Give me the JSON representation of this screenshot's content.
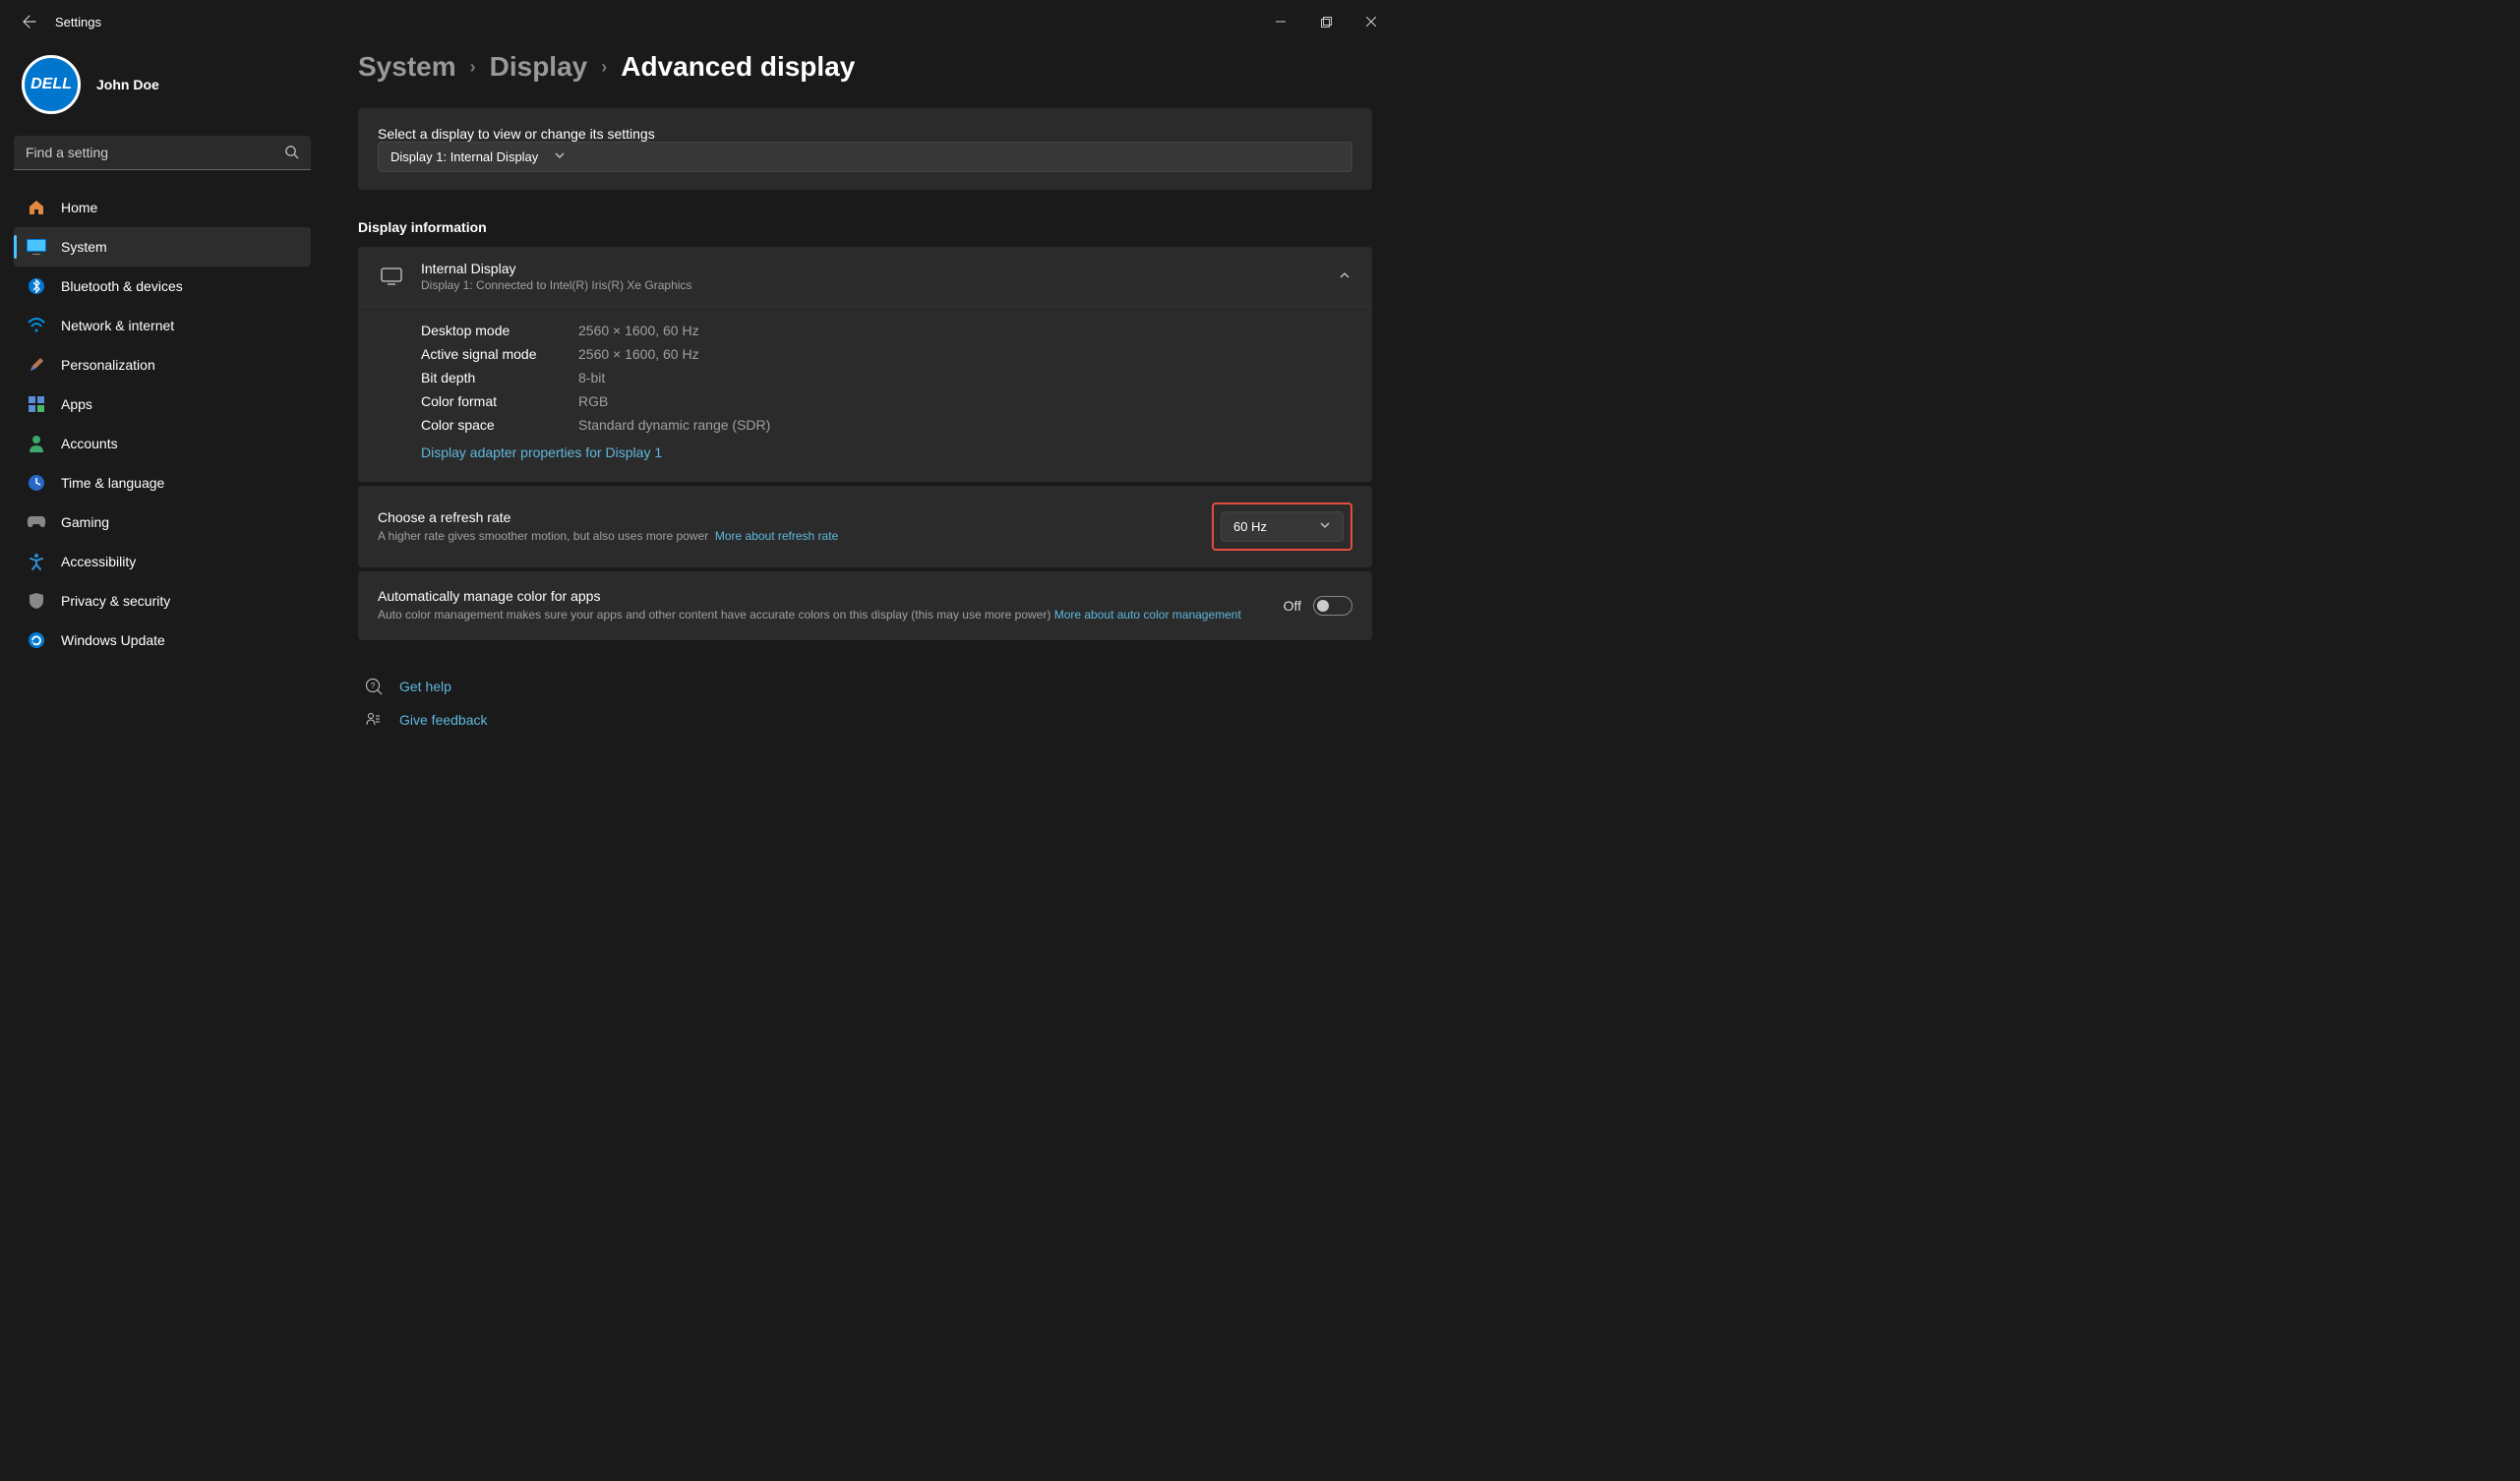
{
  "app": {
    "title": "Settings"
  },
  "user": {
    "name": "John Doe",
    "avatar_text": "DELL"
  },
  "search": {
    "placeholder": "Find a setting"
  },
  "nav": [
    {
      "label": "Home",
      "icon": "home"
    },
    {
      "label": "System",
      "icon": "system",
      "active": true
    },
    {
      "label": "Bluetooth & devices",
      "icon": "bluetooth"
    },
    {
      "label": "Network & internet",
      "icon": "wifi"
    },
    {
      "label": "Personalization",
      "icon": "brush"
    },
    {
      "label": "Apps",
      "icon": "apps"
    },
    {
      "label": "Accounts",
      "icon": "person"
    },
    {
      "label": "Time & language",
      "icon": "clock"
    },
    {
      "label": "Gaming",
      "icon": "gamepad"
    },
    {
      "label": "Accessibility",
      "icon": "accessibility"
    },
    {
      "label": "Privacy & security",
      "icon": "shield"
    },
    {
      "label": "Windows Update",
      "icon": "update"
    }
  ],
  "breadcrumb": {
    "items": [
      "System",
      "Display"
    ],
    "current": "Advanced display"
  },
  "select_display": {
    "prompt": "Select a display to view or change its settings",
    "selected": "Display 1: Internal Display"
  },
  "display_info": {
    "heading": "Display information",
    "title": "Internal Display",
    "subtitle": "Display 1: Connected to Intel(R) Iris(R) Xe Graphics",
    "rows": [
      {
        "key": "Desktop mode",
        "val": "2560 × 1600, 60 Hz"
      },
      {
        "key": "Active signal mode",
        "val": "2560 × 1600, 60 Hz"
      },
      {
        "key": "Bit depth",
        "val": "8-bit"
      },
      {
        "key": "Color format",
        "val": "RGB"
      },
      {
        "key": "Color space",
        "val": "Standard dynamic range (SDR)"
      }
    ],
    "adapter_link": "Display adapter properties for Display 1"
  },
  "refresh": {
    "title": "Choose a refresh rate",
    "subtitle": "A higher rate gives smoother motion, but also uses more power",
    "learn_more": "More about refresh rate",
    "selected": "60 Hz"
  },
  "auto_color": {
    "title": "Automatically manage color for apps",
    "subtitle": "Auto color management makes sure your apps and other content have accurate colors on this display (this may use more power)",
    "learn_more": "More about auto color management",
    "state": "Off"
  },
  "footer": {
    "help": "Get help",
    "feedback": "Give feedback"
  }
}
